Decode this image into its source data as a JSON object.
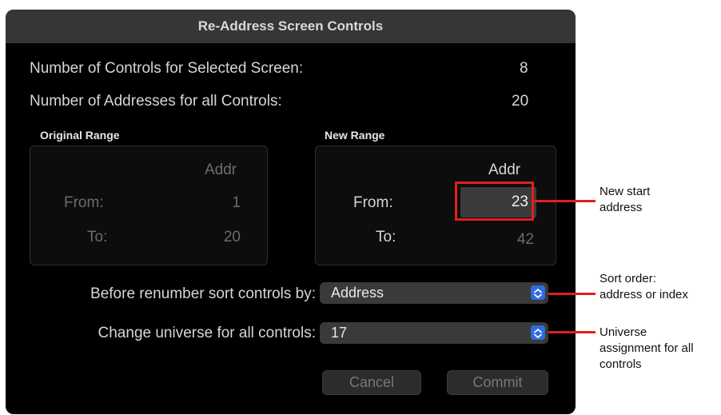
{
  "dialog": {
    "title": "Re-Address Screen Controls",
    "controls_label": "Number of Controls for Selected Screen:",
    "controls_value": "8",
    "addresses_label": "Number of Addresses for all Controls:",
    "addresses_value": "20"
  },
  "original_range": {
    "title": "Original Range",
    "addr_header": "Addr",
    "from_label": "From:",
    "from_value": "1",
    "to_label": "To:",
    "to_value": "20"
  },
  "new_range": {
    "title": "New Range",
    "addr_header": "Addr",
    "from_label": "From:",
    "from_value": "23",
    "to_label": "To:",
    "to_value": "42"
  },
  "sort": {
    "label": "Before renumber sort controls by:",
    "value": "Address"
  },
  "universe": {
    "label": "Change universe for all controls:",
    "value": "17"
  },
  "buttons": {
    "cancel": "Cancel",
    "commit": "Commit"
  },
  "annotations": {
    "start": [
      "New start",
      "address"
    ],
    "sort": [
      "Sort order:",
      "address or index"
    ],
    "universe": [
      "Universe",
      "assignment for all",
      "controls"
    ]
  },
  "colors": {
    "accent": "#2f6ce0",
    "highlight": "#e0201c",
    "dialog_bg": "#000000",
    "titlebar": "#363636"
  }
}
